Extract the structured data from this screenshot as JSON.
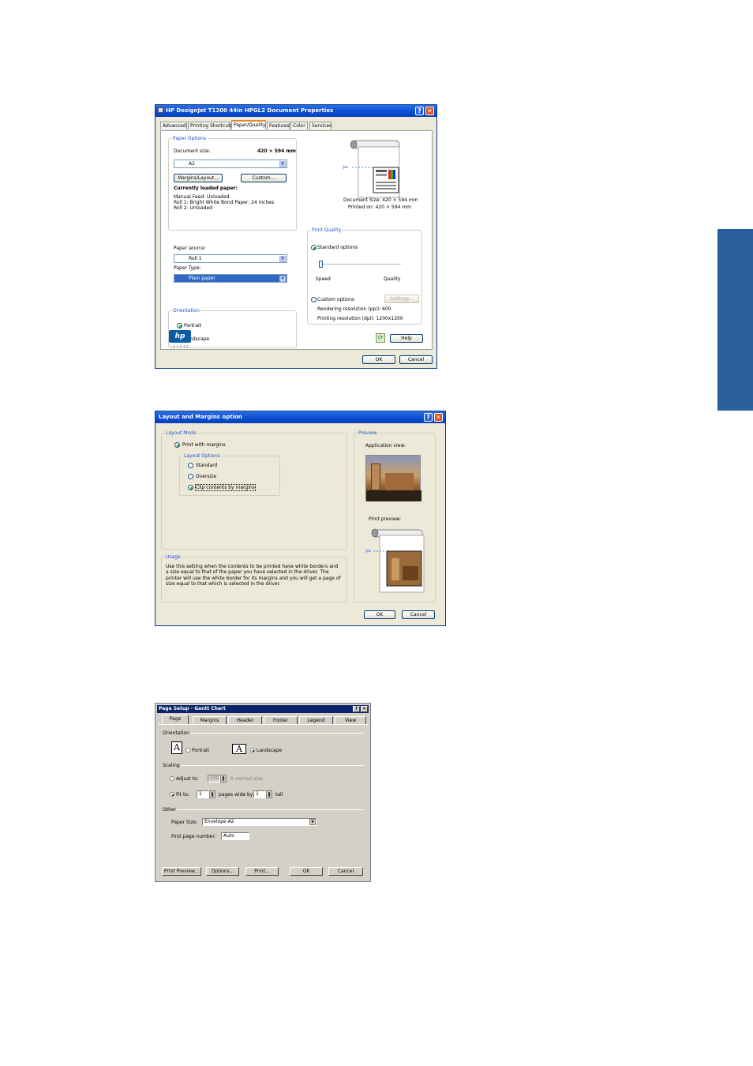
{
  "dialog1": {
    "title": "HP DesignJet T1200 44in HPGL2 Document Properties",
    "tabs": [
      "Advanced",
      "Printing Shortcuts",
      "Paper/Quality",
      "Features",
      "Color",
      "Services"
    ],
    "active_tab": "Paper/Quality",
    "paper_options_label": "Paper Options",
    "document_size_label": "Document size:",
    "document_size_value": "420 × 594 mm",
    "size_select": "A2",
    "margins_button": "Margins/Layout...",
    "custom_button": "Custom...",
    "loaded_paper_title": "Currently loaded paper:",
    "loaded_paper_lines": [
      "Manual Feed: Unloaded",
      "Roll 1: Bright White Bond Paper, 24 inches",
      "Roll 2: Unloaded"
    ],
    "paper_source_label": "Paper source:",
    "paper_source_value": "Roll 1",
    "paper_type_label": "Paper Type:",
    "paper_type_value": "Plain paper",
    "orientation_label": "Orientation",
    "portrait": "Portrait",
    "landscape": "Landscape",
    "preview_doc_size": "Document Size: 420 × 594 mm",
    "preview_printed_on": "Printed on: 420 × 594 mm",
    "print_quality_label": "Print Quality",
    "standard_options": "Standard options",
    "speed": "Speed",
    "quality": "Quality",
    "custom_options": "Custom options",
    "settings_button": "Settings...",
    "rendering_resolution": "Rendering resolution (ppi): 600",
    "printing_resolution": "Printing resolution (dpi): 1200x1200",
    "help_button": "Help",
    "ok_button": "OK",
    "cancel_button": "Cancel",
    "logo_text": "hp",
    "logo_sub": "invent"
  },
  "dialog2": {
    "title": "Layout and Margins option",
    "layout_mode_label": "Layout Mode",
    "print_with_margins": "Print with margins",
    "layout_options_label": "Layout Options",
    "standard": "Standard",
    "oversize": "Oversize",
    "clip_contents": "Clip contents by margins",
    "usage_label": "Usage",
    "usage_text": "Use this setting when the contents to be printed have white borders and a size equal to that of the paper you have selected in the driver. The printer will use the white border for its margins and you will get a page of size equal to that which is selected in the driver.",
    "preview_label": "Preview",
    "application_view": "Application view:",
    "print_preview": "Print preview:",
    "ok_button": "OK",
    "cancel_button": "Cancel"
  },
  "dialog3": {
    "title": "Page Setup - Gantt Chart",
    "tabs": [
      "Page",
      "Margins",
      "Header",
      "Footer",
      "Legend",
      "View"
    ],
    "orientation_label": "Orientation",
    "portrait": "Portrait",
    "landscape": "Landscape",
    "scaling_label": "Scaling",
    "adjust_to": "Adjust to:",
    "adjust_value": "100",
    "normal_size": "% normal size",
    "fit_to": "Fit to:",
    "fit_wide_value": "1",
    "pages_wide_by": "pages wide by",
    "fit_tall_value": "1",
    "tall": "tall",
    "other_label": "Other",
    "paper_size_label": "Paper Size:",
    "paper_size_value": "Envelope A2",
    "first_page_label": "First page number:",
    "first_page_value": "Auto",
    "print_preview_button": "Print Preview...",
    "options_button": "Options...",
    "print_button": "Print...",
    "ok_button": "OK",
    "cancel_button": "Cancel"
  },
  "colors": {
    "side_tab": "#2a5f9e",
    "xp_title": "#0a4fd4",
    "classic_title": "#0a246a"
  }
}
